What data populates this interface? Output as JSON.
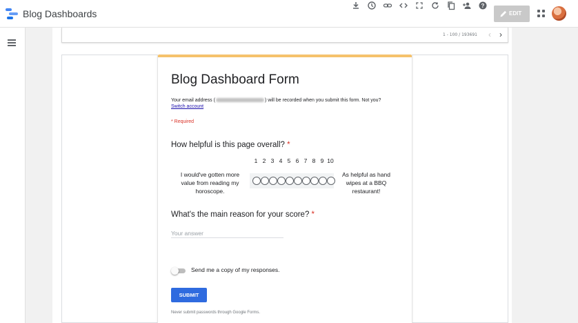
{
  "app": {
    "title": "Blog Dashboards",
    "logo_colors": [
      "#4285f4",
      "#669df6",
      "#1a73e8"
    ]
  },
  "toolbar": {
    "icons": [
      "download-icon",
      "history-icon",
      "link-icon",
      "embed-code-icon",
      "fullscreen-icon",
      "refresh-icon",
      "copy-icon",
      "share-user-icon",
      "help-icon"
    ],
    "edit_label": "EDIT"
  },
  "table_pager": {
    "range": "1 - 100 / 193691"
  },
  "form": {
    "accent_color": "#f5c26b",
    "title": "Blog Dashboard Form",
    "email_prefix": "Your email address (",
    "email_suffix": ") will be recorded when you submit this form. Not you?",
    "switch_account": "Switch account",
    "required_note": "* Required",
    "q1": {
      "title": "How helpful is this page overall?",
      "required_marker": "*",
      "scale": [
        "1",
        "2",
        "3",
        "4",
        "5",
        "6",
        "7",
        "8",
        "9",
        "10"
      ],
      "low_label": "I would've gotten more value from reading my horoscope.",
      "high_label": "As helpful as hand wipes at a BBQ restaurant!"
    },
    "q2": {
      "title": "What's the main reason for your score?",
      "required_marker": "*",
      "placeholder": "Your answer",
      "value": ""
    },
    "copy_toggle": {
      "label": "Send me a copy of my responses.",
      "checked": false
    },
    "submit_label": "SUBMIT",
    "footer_note": "Never submit passwords through Google Forms.",
    "submit_color": "#2f6bdf"
  }
}
